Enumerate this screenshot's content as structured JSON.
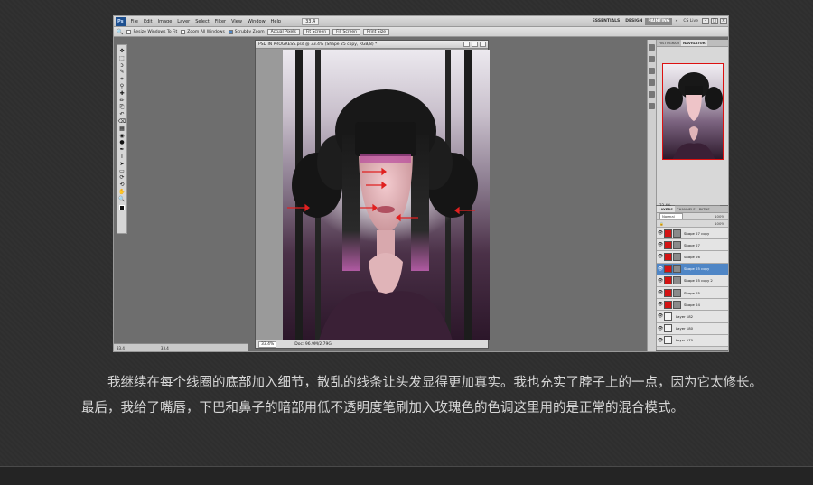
{
  "menubar": {
    "logo": "Ps",
    "items": [
      "File",
      "Edit",
      "Image",
      "Layer",
      "Select",
      "Filter",
      "View",
      "Window",
      "Help"
    ],
    "zoom": "33.4",
    "workspaces": [
      "ESSENTIALS",
      "DESIGN",
      "PAINTING"
    ],
    "active_workspace": "PAINTING",
    "more": "»",
    "cslive": "CS Live"
  },
  "options_bar": {
    "resize_windows": "Resize Windows To Fit",
    "zoom_all_windows": "Zoom All Windows",
    "scrubby_zoom": "Scrubby Zoom",
    "buttons": [
      "Actual Pixels",
      "Fit Screen",
      "Fill Screen",
      "Print Size"
    ]
  },
  "toolbox": {
    "tools": [
      "move-tool",
      "marquee-tool",
      "lasso-tool",
      "quick-select-tool",
      "crop-tool",
      "eyedropper-tool",
      "healing-tool",
      "brush-tool",
      "clone-stamp-tool",
      "history-brush-tool",
      "eraser-tool",
      "gradient-tool",
      "blur-tool",
      "dodge-tool",
      "pen-tool",
      "type-tool",
      "path-select-tool",
      "shape-tool",
      "3d-rotate-tool",
      "3d-orbit-tool",
      "hand-tool",
      "zoom-tool"
    ],
    "glyphs": [
      "✥",
      "⬚",
      "ↄ",
      "✎",
      "⌗",
      "⚲",
      "✚",
      "✏",
      "⎘",
      "↶",
      "⌫",
      "▦",
      "◉",
      "●",
      "✒",
      "T",
      "➤",
      "▭",
      "⟳",
      "⟲",
      "✋",
      "🔍"
    ]
  },
  "document": {
    "title": "PSD IN PROGRESS.psd @ 33.4% (Shape 25 copy, RGB/8) *",
    "zoom": "33.4%",
    "doc_size": "Doc: 96.9M/2.79G"
  },
  "navigator": {
    "tabs": [
      "HISTOGRAM",
      "NAVIGATOR"
    ],
    "active_tab": "NAVIGATOR",
    "zoom": "33.4%"
  },
  "layers": {
    "tabs": [
      "LAYERS",
      "CHANNELS",
      "PATHS"
    ],
    "blend_mode": "Normal",
    "opacity": "100%",
    "fill": "100%",
    "rows": [
      {
        "name": "Shape 27 copy",
        "thumb": "red",
        "mask": true,
        "selected": false
      },
      {
        "name": "Shape 27",
        "thumb": "red",
        "mask": true,
        "selected": false
      },
      {
        "name": "Shape 26",
        "thumb": "red",
        "mask": true,
        "selected": false
      },
      {
        "name": "Shape 25 copy",
        "thumb": "red",
        "mask": true,
        "selected": true
      },
      {
        "name": "Shape 25 copy 2",
        "thumb": "red",
        "mask": true,
        "selected": false
      },
      {
        "name": "Shape 25",
        "thumb": "red",
        "mask": true,
        "selected": false
      },
      {
        "name": "Shape 24",
        "thumb": "red",
        "mask": true,
        "selected": false
      },
      {
        "name": "Layer 182",
        "thumb": "white",
        "mask": false,
        "selected": false
      },
      {
        "name": "Layer 180",
        "thumb": "white",
        "mask": false,
        "selected": false
      },
      {
        "name": "Layer 179",
        "thumb": "white",
        "mask": false,
        "selected": false
      }
    ]
  },
  "taskbar": {
    "items": [
      "33.4",
      "33.4"
    ]
  },
  "caption": {
    "paragraph": "我继续在每个线圈的底部加入细节，散乱的线条让头发显得更加真实。我也充实了脖子上的一点，因为它太修长。最后，我给了嘴唇，下巴和鼻子的暗部用低不透明度笔刷加入玫瑰色的色调这里用的是正常的混合模式。"
  },
  "colors": {
    "page_bg": "#2e2e2e",
    "caption_text": "#d6d6d6",
    "arrow_red": "#e02020",
    "selected_layer": "#4f86c6"
  }
}
